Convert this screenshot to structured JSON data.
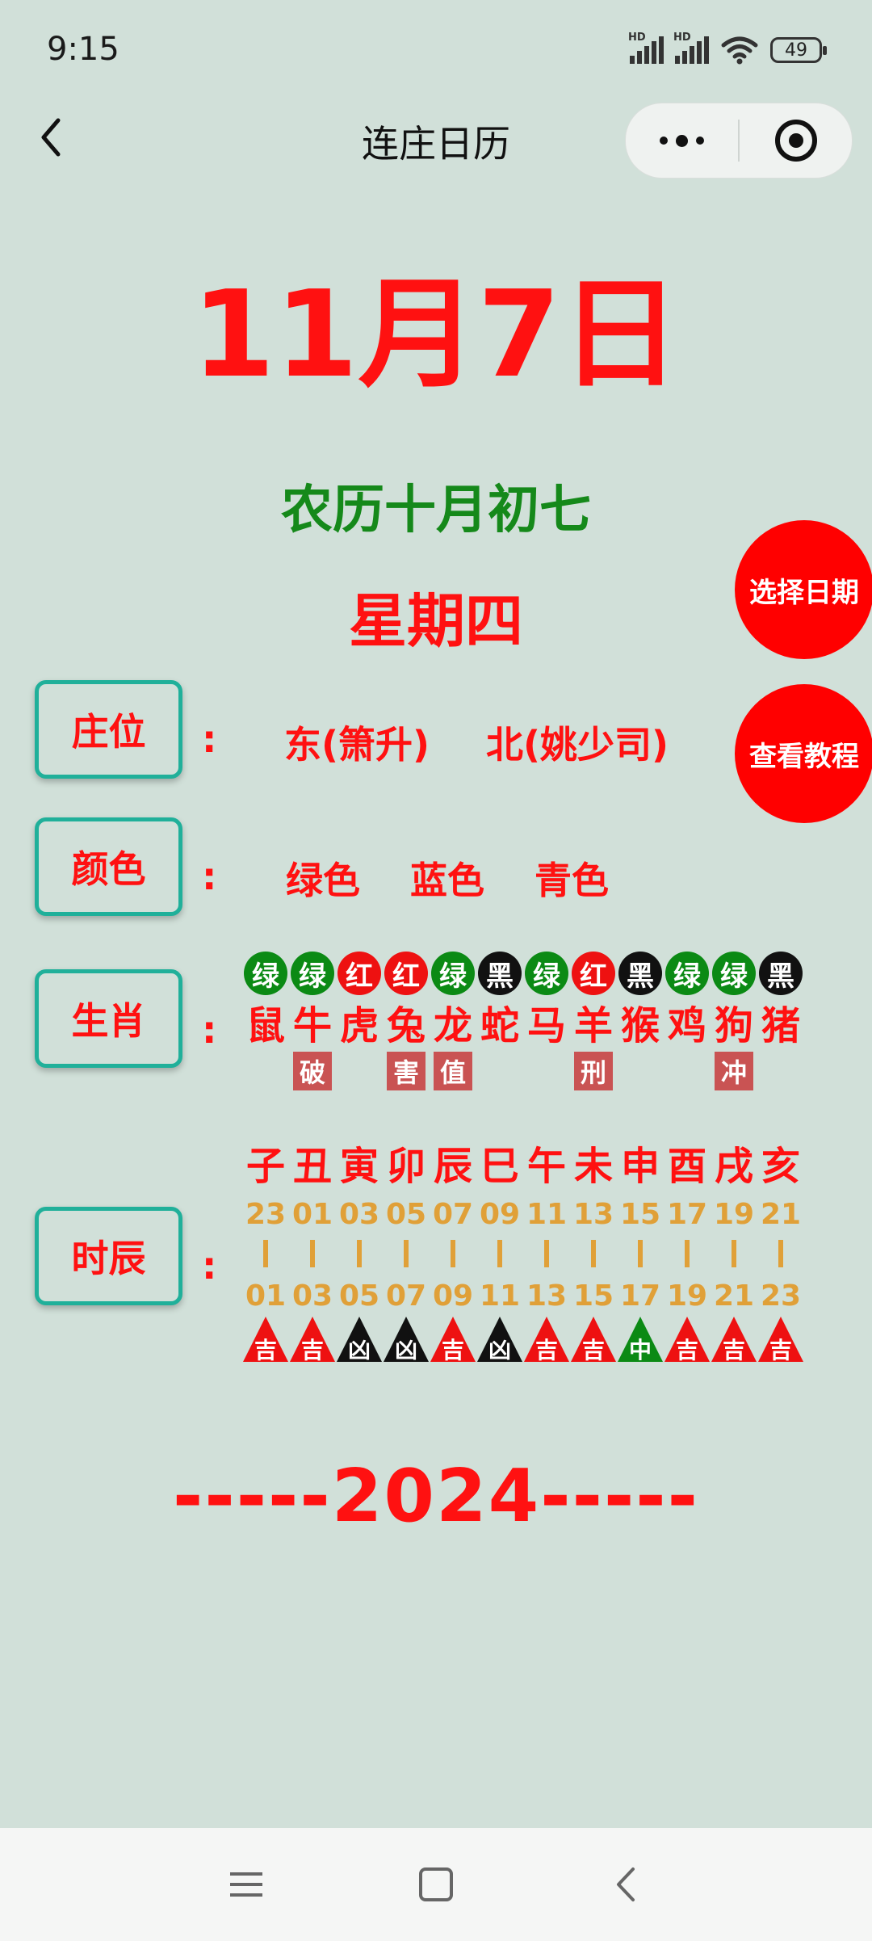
{
  "status_bar": {
    "time": "9:15",
    "signal_label_1": "HD",
    "signal_label_2": "HD",
    "battery": "49",
    "icons": [
      "signal-icon",
      "signal-icon",
      "wifi-icon",
      "battery-icon"
    ]
  },
  "nav": {
    "title": "连庄日历",
    "back_icon": "chevron-left-icon",
    "more_icon": "more-dots-icon",
    "close_icon": "target-icon"
  },
  "date": {
    "main": "11月7日",
    "lunar": "农历十月初七",
    "weekday": "星期四"
  },
  "buttons": {
    "select_date": "选择日期",
    "tutorial": "查看教程"
  },
  "rows": {
    "position_label": "庄位",
    "position_values": [
      "东(箫升)",
      "北(姚少司)"
    ],
    "color_label": "颜色",
    "color_values": [
      "绿色",
      "蓝色",
      "青色"
    ],
    "zodiac_label": "生肖",
    "hour_label": "时辰",
    "colon": ":"
  },
  "zodiac": [
    {
      "badge": "绿",
      "badge_color": "#0b8a14",
      "name": "鼠",
      "tag": ""
    },
    {
      "badge": "绿",
      "badge_color": "#0b8a14",
      "name": "牛",
      "tag": "破"
    },
    {
      "badge": "红",
      "badge_color": "#ee1111",
      "name": "虎",
      "tag": ""
    },
    {
      "badge": "红",
      "badge_color": "#ee1111",
      "name": "兔",
      "tag": "害"
    },
    {
      "badge": "绿",
      "badge_color": "#0b8a14",
      "name": "龙",
      "tag": "值"
    },
    {
      "badge": "黑",
      "badge_color": "#111111",
      "name": "蛇",
      "tag": ""
    },
    {
      "badge": "绿",
      "badge_color": "#0b8a14",
      "name": "马",
      "tag": ""
    },
    {
      "badge": "红",
      "badge_color": "#ee1111",
      "name": "羊",
      "tag": "刑"
    },
    {
      "badge": "黑",
      "badge_color": "#111111",
      "name": "猴",
      "tag": ""
    },
    {
      "badge": "绿",
      "badge_color": "#0b8a14",
      "name": "鸡",
      "tag": ""
    },
    {
      "badge": "绿",
      "badge_color": "#0b8a14",
      "name": "狗",
      "tag": "冲"
    },
    {
      "badge": "黑",
      "badge_color": "#111111",
      "name": "猪",
      "tag": ""
    }
  ],
  "hours": [
    {
      "branch": "子",
      "start": "23",
      "end": "01",
      "luck": "吉",
      "luck_color": "#ee1111"
    },
    {
      "branch": "丑",
      "start": "01",
      "end": "03",
      "luck": "吉",
      "luck_color": "#ee1111"
    },
    {
      "branch": "寅",
      "start": "03",
      "end": "05",
      "luck": "凶",
      "luck_color": "#111111"
    },
    {
      "branch": "卯",
      "start": "05",
      "end": "07",
      "luck": "凶",
      "luck_color": "#111111"
    },
    {
      "branch": "辰",
      "start": "07",
      "end": "09",
      "luck": "吉",
      "luck_color": "#ee1111"
    },
    {
      "branch": "巳",
      "start": "09",
      "end": "11",
      "luck": "凶",
      "luck_color": "#111111"
    },
    {
      "branch": "午",
      "start": "11",
      "end": "13",
      "luck": "吉",
      "luck_color": "#ee1111"
    },
    {
      "branch": "未",
      "start": "13",
      "end": "15",
      "luck": "吉",
      "luck_color": "#ee1111"
    },
    {
      "branch": "申",
      "start": "15",
      "end": "17",
      "luck": "中",
      "luck_color": "#0b8a14"
    },
    {
      "branch": "酉",
      "start": "17",
      "end": "19",
      "luck": "吉",
      "luck_color": "#ee1111"
    },
    {
      "branch": "戌",
      "start": "19",
      "end": "21",
      "luck": "吉",
      "luck_color": "#ee1111"
    },
    {
      "branch": "亥",
      "start": "21",
      "end": "23",
      "luck": "吉",
      "luck_color": "#ee1111"
    }
  ],
  "hour_separator": "|",
  "year_line": "-----2024-----",
  "bottom_nav": {
    "icons": [
      "menu-icon",
      "home-icon",
      "back-icon"
    ]
  },
  "colors": {
    "background": "#d1e0d9",
    "accent_red": "#ff1111",
    "green": "#15891a",
    "teal_border": "#20b09a",
    "hour_orange": "#e0a038"
  }
}
